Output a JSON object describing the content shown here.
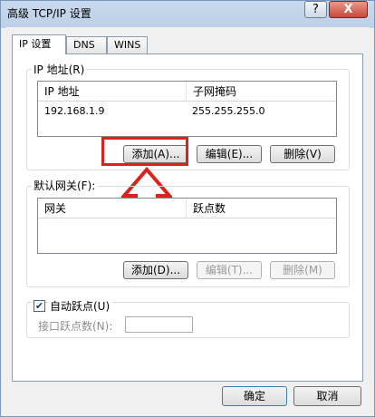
{
  "window": {
    "title": "高级 TCP/IP 设置",
    "help_glyph": "?",
    "close_glyph": "X"
  },
  "tabs": [
    {
      "label": "IP 设置",
      "selected": true
    },
    {
      "label": "DNS",
      "selected": false
    },
    {
      "label": "WINS",
      "selected": false
    }
  ],
  "ip_group": {
    "title": "IP 地址(R)",
    "columns": [
      "IP 地址",
      "子网掩码"
    ],
    "rows": [
      {
        "ip": "192.168.1.9",
        "mask": "255.255.255.0"
      }
    ],
    "buttons": {
      "add": "添加(A)...",
      "edit": "编辑(E)...",
      "delete": "删除(V)"
    }
  },
  "gateway_group": {
    "title": "默认网关(F):",
    "columns": [
      "网关",
      "跃点数"
    ],
    "rows": [],
    "buttons": {
      "add": "添加(D)...",
      "edit": "编辑(T)...",
      "delete": "删除(M)"
    }
  },
  "metric": {
    "auto_label": "自动跃点(U)",
    "auto_checked": true,
    "check_glyph": "✔",
    "interface_label": "接口跃点数(N):",
    "interface_value": ""
  },
  "footer": {
    "ok": "确定",
    "cancel": "取消"
  },
  "annotation": {
    "color": "#e0201c"
  }
}
